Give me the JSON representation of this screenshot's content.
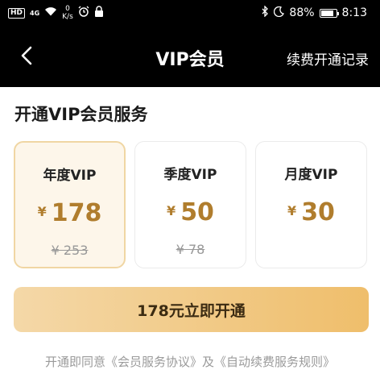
{
  "status_bar": {
    "hd": "HD",
    "network": "4G",
    "speed_value": "0",
    "speed_unit": "K/s",
    "battery": "88%",
    "time": "8:13",
    "battery_level": 0.88
  },
  "nav": {
    "title": "VIP会员",
    "right_link": "续费开通记录"
  },
  "section_title": "开通VIP会员服务",
  "plans": [
    {
      "name": "年度VIP",
      "currency": "¥",
      "price": "178",
      "original": "¥ 253",
      "selected": true
    },
    {
      "name": "季度VIP",
      "currency": "¥",
      "price": "50",
      "original": "¥ 78",
      "selected": false
    },
    {
      "name": "月度VIP",
      "currency": "¥",
      "price": "30",
      "original": "",
      "selected": false
    }
  ],
  "cta": {
    "label": "178元立即开通"
  },
  "agreement": {
    "prefix": "开通即同意",
    "link1": "《会员服务协议》",
    "middle": "及",
    "link2": "《自动续费服务规则》"
  },
  "colors": {
    "price_gold": "#b07d2d",
    "selected_border": "#f0d6a3",
    "selected_bg": "#fdf6ea",
    "cta_start": "#f4d8a8",
    "cta_end": "#efbe6b"
  }
}
